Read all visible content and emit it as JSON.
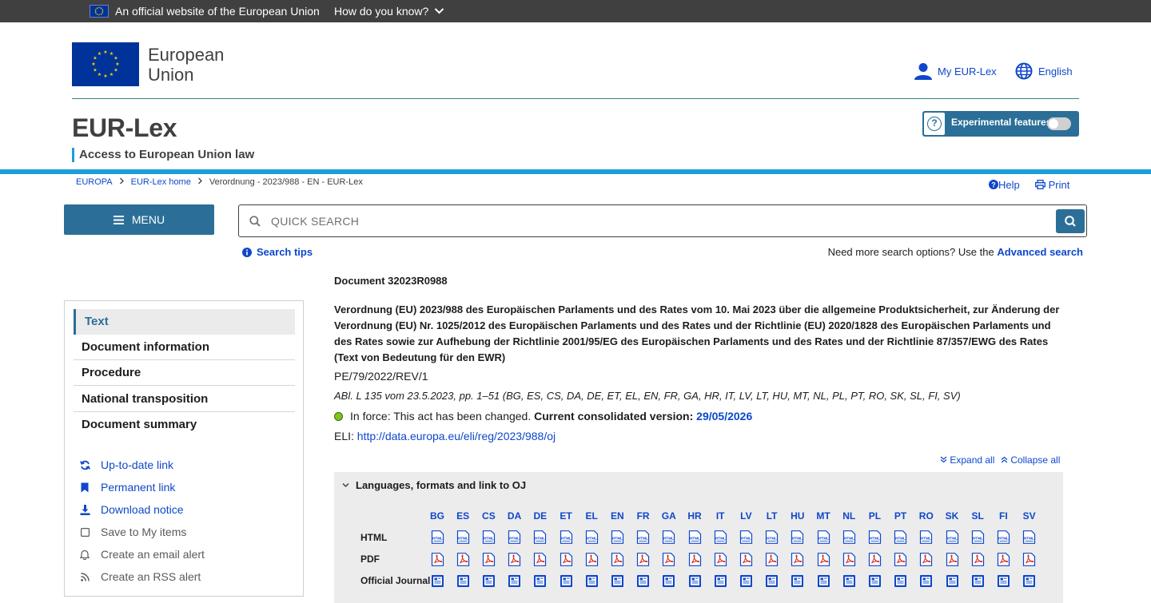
{
  "eu_banner": {
    "official_text": "An official website of the European Union",
    "how_know": "How do you know?"
  },
  "header": {
    "org_name_line1": "European",
    "org_name_line2": "Union",
    "my_eurlex": "My EUR-Lex",
    "language": "English",
    "site_title": "EUR-Lex",
    "site_subtitle": "Access to European Union law",
    "experimental_label": "Experimental features",
    "experimental_enabled": false
  },
  "breadcrumb": {
    "items": [
      "EUROPA",
      "EUR-Lex home",
      "Verordnung - 2023/988 - EN - EUR-Lex"
    ]
  },
  "utility": {
    "help": "Help",
    "print": "Print"
  },
  "menu_label": "MENU",
  "search": {
    "placeholder": "QUICK SEARCH",
    "tips": "Search tips",
    "advanced_prefix": "Need more search options? Use the",
    "advanced_link": "Advanced search"
  },
  "sidebar": {
    "nav": [
      {
        "label": "Text",
        "active": true
      },
      {
        "label": "Document information",
        "active": false
      },
      {
        "label": "Procedure",
        "active": false
      },
      {
        "label": "National transposition",
        "active": false
      },
      {
        "label": "Document summary",
        "active": false
      }
    ],
    "tools": [
      {
        "label": "Up-to-date link",
        "icon": "refresh-icon"
      },
      {
        "label": "Permanent link",
        "icon": "bookmark-icon"
      },
      {
        "label": "Download notice",
        "icon": "download-icon"
      },
      {
        "label": "Save to My items",
        "icon": "checkbox-icon"
      },
      {
        "label": "Create an email alert",
        "icon": "bell-icon"
      },
      {
        "label": "Create an RSS alert",
        "icon": "rss-icon"
      }
    ]
  },
  "document": {
    "id_label": "Document 32023R0988",
    "title": "Verordnung (EU) 2023/988 des Europäischen Parlaments und des Rates vom 10. Mai 2023 über die allgemeine Produktsicherheit, zur Änderung der Verordnung (EU) Nr. 1025/2012 des Europäischen Parlaments und des Rates und der Richtlinie (EU) 2020/1828 des Europäischen Parlaments und des Rates sowie zur Aufhebung der Richtlinie 2001/95/EG des Europäischen Parlaments und des Rates und der Richtlinie 87/357/EWG des Rates (Text von Bedeutung für den EWR)",
    "reference": "PE/79/2022/REV/1",
    "oj_ref": "ABl. L 135 vom 23.5.2023, pp. 1–51 (BG, ES, CS, DA, DE, ET, EL, EN, FR, GA, HR, IT, LV, LT, HU, MT, NL, PL, PT, RO, SK, SL, FI, SV)",
    "in_force_text": "In force: This act has been changed.",
    "consolidated_label": "Current consolidated version:",
    "consolidated_date": "29/05/2026",
    "eli_label": "ELI:",
    "eli_link": "http://data.europa.eu/eli/reg/2023/988/oj",
    "expand_all": "Expand all",
    "collapse_all": "Collapse all"
  },
  "languages_panel": {
    "heading": "Languages, formats and link to OJ",
    "codes": [
      "BG",
      "ES",
      "CS",
      "DA",
      "DE",
      "ET",
      "EL",
      "EN",
      "FR",
      "GA",
      "HR",
      "IT",
      "LV",
      "LT",
      "HU",
      "MT",
      "NL",
      "PL",
      "PT",
      "RO",
      "SK",
      "SL",
      "FI",
      "SV"
    ],
    "rows": [
      "HTML",
      "PDF",
      "Official Journal"
    ]
  },
  "colors": {
    "primary": "#2b6f98",
    "link": "#0e47cb",
    "accent_line": "#1a9fd9",
    "eu_blue": "#003399",
    "eu_yellow": "#ffcc00",
    "status_green": "#7dc41f"
  }
}
